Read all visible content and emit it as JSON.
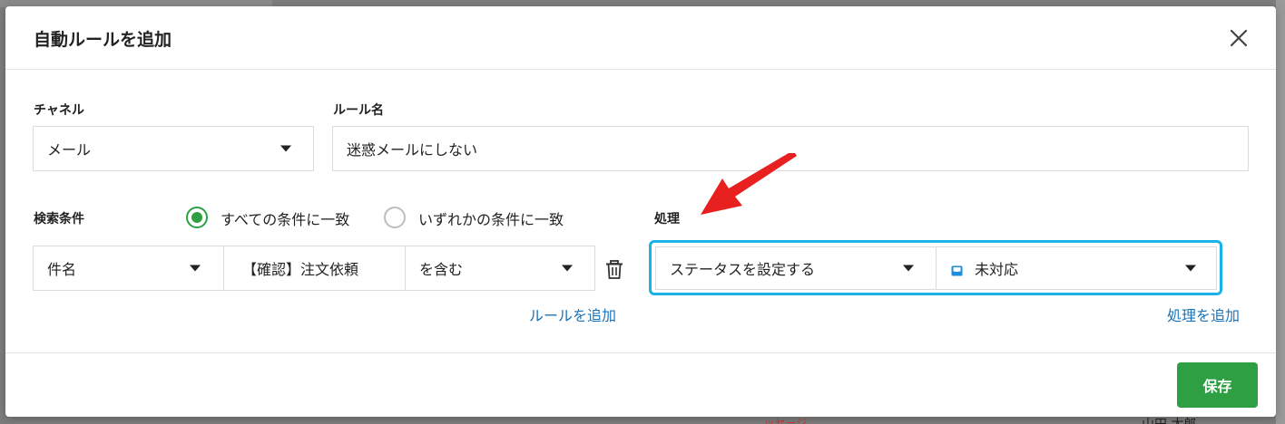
{
  "dialog": {
    "title": "自動ルールを追加"
  },
  "channel": {
    "label": "チャネル",
    "value": "メール"
  },
  "rule_name": {
    "label": "ルール名",
    "value": "迷惑メールにしない"
  },
  "conditions": {
    "label": "検索条件",
    "match_all_label": "すべての条件に一致",
    "match_any_label": "いずれかの条件に一致",
    "selected": "all",
    "row": {
      "field": "件名",
      "value": "【確認】注文依頼",
      "operator": "を含む"
    },
    "add_rule_label": "ルールを追加"
  },
  "actions": {
    "label": "処理",
    "row": {
      "action": "ステータスを設定する",
      "status": "未対応"
    },
    "add_action_label": "処理を追加"
  },
  "footer": {
    "save_label": "保存"
  },
  "background": {
    "partial_text": "山田 太郎",
    "partial_red_text": "...ッセージ..."
  },
  "colors": {
    "accent_green": "#2ea043",
    "link_blue": "#1a73b8",
    "highlight_cyan": "#1ab3e6",
    "annotation_red": "#e8201f"
  },
  "icons": {
    "close": "close-icon",
    "dropdown": "caret-down-icon",
    "delete": "trash-icon",
    "status": "inbox-icon",
    "annotation": "red-arrow-icon"
  }
}
